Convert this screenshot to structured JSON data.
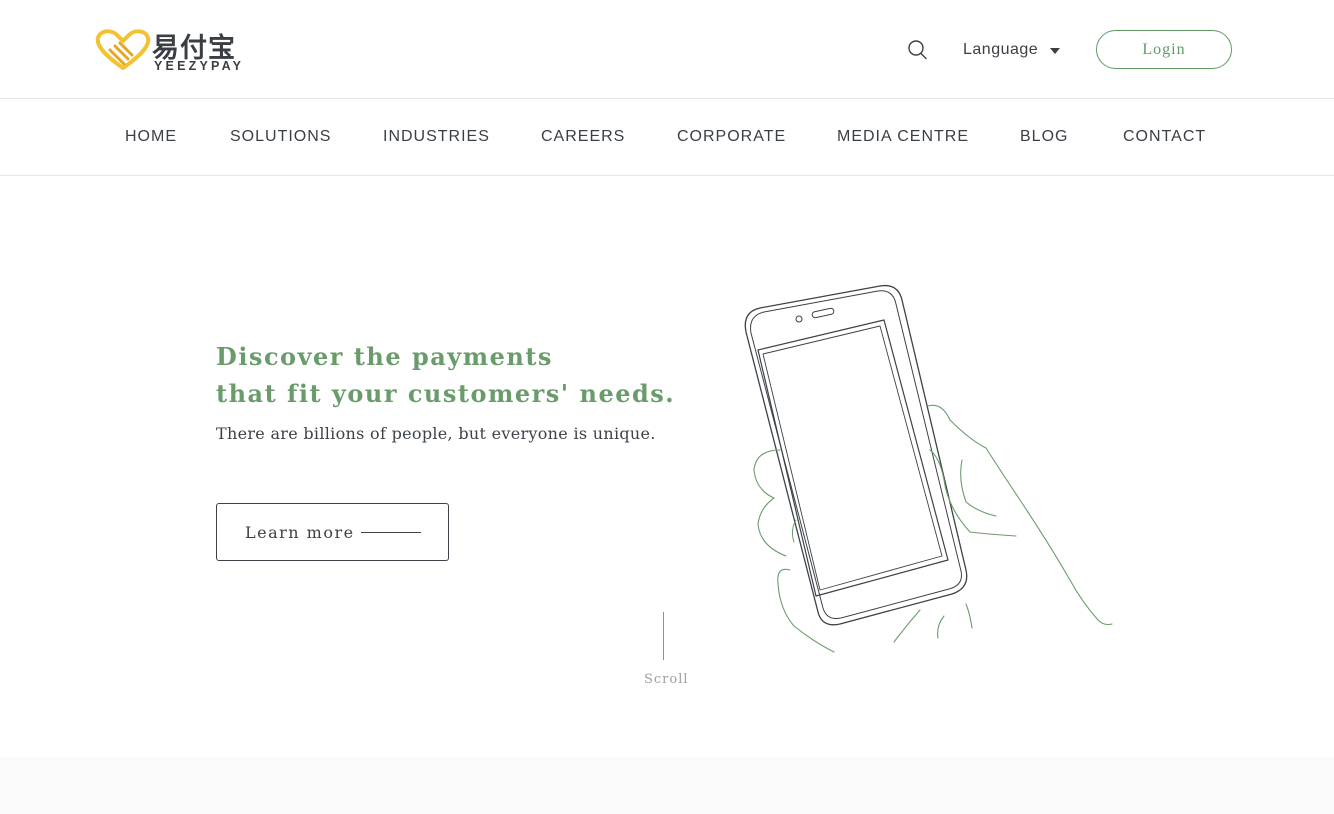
{
  "header": {
    "logo_cn": "易付宝",
    "logo_en": "YEEZYPAY",
    "language_label": "Language",
    "login_label": "Login"
  },
  "nav": {
    "items": [
      {
        "label": "HOME"
      },
      {
        "label": "SOLUTIONS"
      },
      {
        "label": "INDUSTRIES"
      },
      {
        "label": "CAREERS"
      },
      {
        "label": "CORPORATE"
      },
      {
        "label": "MEDIA CENTRE"
      },
      {
        "label": "BLOG"
      },
      {
        "label": "CONTACT"
      }
    ]
  },
  "hero": {
    "title_line1": "Discover the payments",
    "title_line2": "that fit your customers' needs.",
    "subtitle": "There are billions of people, but everyone is unique.",
    "cta_label": "Learn more",
    "scroll_label": "Scroll"
  },
  "colors": {
    "brand_green": "#6a9c6b",
    "logo_yellow": "#f2c230",
    "text_dark": "#3c4248"
  },
  "icons": {
    "search": "search-icon",
    "language_caret": "caret-down-icon",
    "phone_illustration": "hand-holding-phone-icon"
  }
}
